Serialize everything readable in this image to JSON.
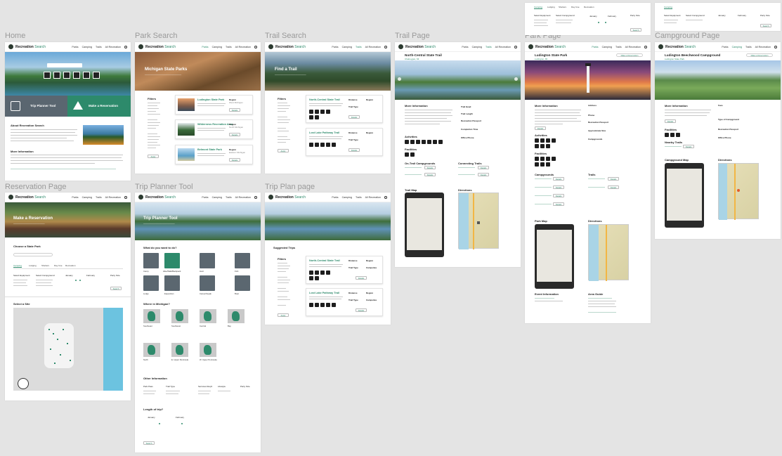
{
  "artboard_labels": {
    "home": "Home",
    "park_search": "Park Search",
    "trail_search": "Trail Search",
    "trail_page": "Trail Page",
    "park_page": "Park Page",
    "campground_page": "Campground Page",
    "reservation_page": "Reservation Page",
    "trip_planner_tool": "Trip Planner Tool",
    "trip_plan_page": "Trip Plan page"
  },
  "nav": {
    "brand": "Recreation",
    "brand_accent": "Search",
    "links": [
      "Parks",
      "Camping",
      "Trails",
      "All Recreation"
    ]
  },
  "colors": {
    "accent": "#2d8a6b",
    "canvas": "#e4e4e4",
    "icon_dark": "#1e1e1e"
  },
  "home": {
    "about_title": "About Recreation Search",
    "more_title": "More Information",
    "trip_planner_title": "Trip Planner Tool",
    "reservation_title": "Make a Reservation"
  },
  "park_search": {
    "hero_title": "Michigan State Parks",
    "filters_title": "Filters",
    "results": [
      {
        "name": "Ludington State Park",
        "region": "West Michigan",
        "details": "Details"
      },
      {
        "name": "Wilderness Recreation Area",
        "region": "North Michigan",
        "details": "Details"
      },
      {
        "name": "Belmont State Park",
        "region": "Eastern Michigan",
        "details": "Details"
      }
    ]
  },
  "trail_search": {
    "hero_title": "Find a Trail",
    "filters_title": "Filters",
    "results": [
      {
        "name": "North-Central State Trail",
        "details": "Details"
      },
      {
        "name": "Lost Lake Pathway Trail",
        "details": "Details"
      }
    ]
  },
  "trail_page": {
    "title": "North-Central State Trail",
    "more_info": "More Information",
    "activities": "Activities",
    "facilities": "Facilities",
    "on_trail_campgrounds": "On-Trail Campgrounds",
    "connecting_trails": "Connecting Trails",
    "trail_map": "Trail Map",
    "directions": "Directions"
  },
  "park_page": {
    "title": "Ludington State Park",
    "reserve": "Make a Reservation",
    "more_info": "More Information",
    "activities": "Activities",
    "facilities": "Facilities",
    "campgrounds": "Campgrounds",
    "trails": "Trails",
    "park_map": "Park Map",
    "directions": "Directions",
    "event_info": "Event Information",
    "area_guide": "Area Guide"
  },
  "campground_page": {
    "title": "Ludington Beechwood Campground",
    "reserve": "Make a Reservation",
    "more_info": "More Information",
    "facilities": "Facilities",
    "nearby_trails": "Nearby Trails",
    "campground_map": "Campground Map",
    "directions": "Directions"
  },
  "reservation_page": {
    "hero_title": "Make a Reservation",
    "choose_park": "Choose a State Park",
    "tabs": [
      "Camping",
      "Lodging",
      "Shelters",
      "Day Use",
      "Recreation"
    ],
    "select_site": "Select a Site"
  },
  "trip_planner": {
    "hero_title": "Trip Planner Tool",
    "q_do": "What do you want to do?",
    "activities": [
      "Camp",
      "Hike/Walk/Backpack",
      "Hunt",
      "Fish",
      "Lodge",
      "Equestrian",
      "Canoe/Kayak",
      "Boat"
    ],
    "q_where": "Where in Michigan?",
    "regions": [
      "Southeast",
      "Southwest",
      "Central",
      "Bay",
      "North",
      "E. Upper Peninsula",
      "W. Upper Peninsula"
    ],
    "other_info": "Other Information",
    "length": "Length of trip?",
    "search": "Search"
  },
  "trip_plan_page": {
    "suggested": "Suggested Trips",
    "filters_title": "Filters",
    "results": [
      {
        "name": "North-Central State Trail",
        "details": "Details"
      },
      {
        "name": "Lost Lake Pathway Trail",
        "details": "Details"
      }
    ]
  }
}
